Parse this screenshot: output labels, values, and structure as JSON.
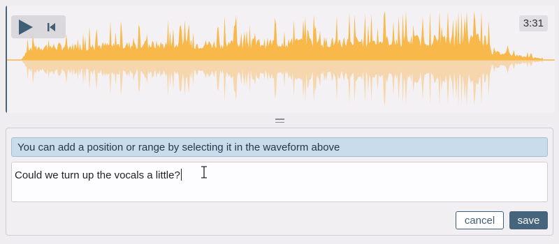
{
  "player": {
    "time": "3:31",
    "controls": {
      "play_icon": "play-icon",
      "rewind_icon": "skip-to-start-icon"
    }
  },
  "comment": {
    "hint": "You can add a position or range by selecting it in the waveform above",
    "text": "Could we turn up the vocals a little?",
    "cancel_label": "cancel",
    "save_label": "save"
  },
  "colors": {
    "waveform": "#f8b84a",
    "waveform_reflection": "#f6d7ad",
    "accent": "#46647c",
    "hint_background": "#c9dceb"
  }
}
